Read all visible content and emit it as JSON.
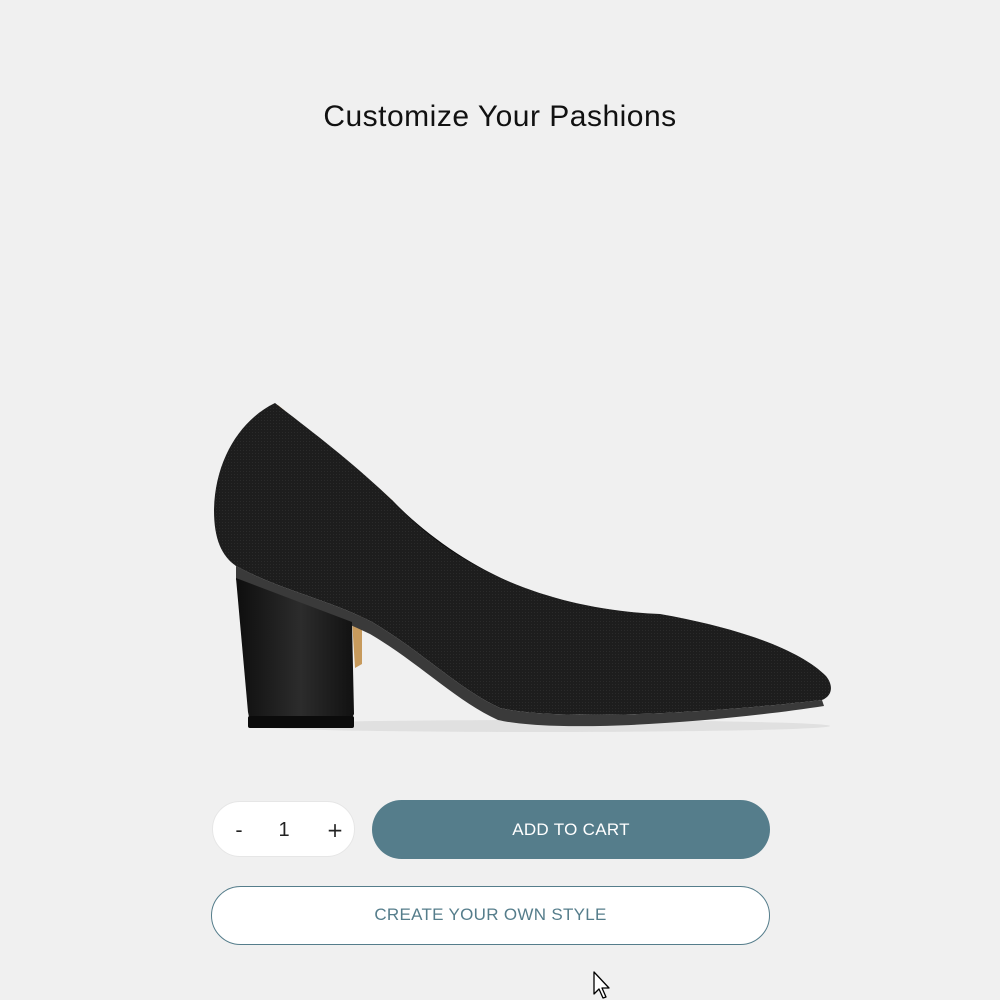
{
  "header": {
    "title": "Customize Your Pashions"
  },
  "product": {
    "image_icon": "black-pump-heel-shoe",
    "colors": {
      "shoe": "#1a1a1a",
      "lining": "#c79a5c",
      "sole": "#3a3a3a"
    }
  },
  "quantity": {
    "minus_label": "-",
    "value": "1",
    "plus_label": "+"
  },
  "actions": {
    "add_to_cart_label": "ADD TO CART",
    "create_style_label": "CREATE YOUR OWN STYLE"
  },
  "theme": {
    "accent": "#557d8b",
    "background": "#f0f0f0"
  },
  "cursor_icon": "mouse-pointer-icon"
}
